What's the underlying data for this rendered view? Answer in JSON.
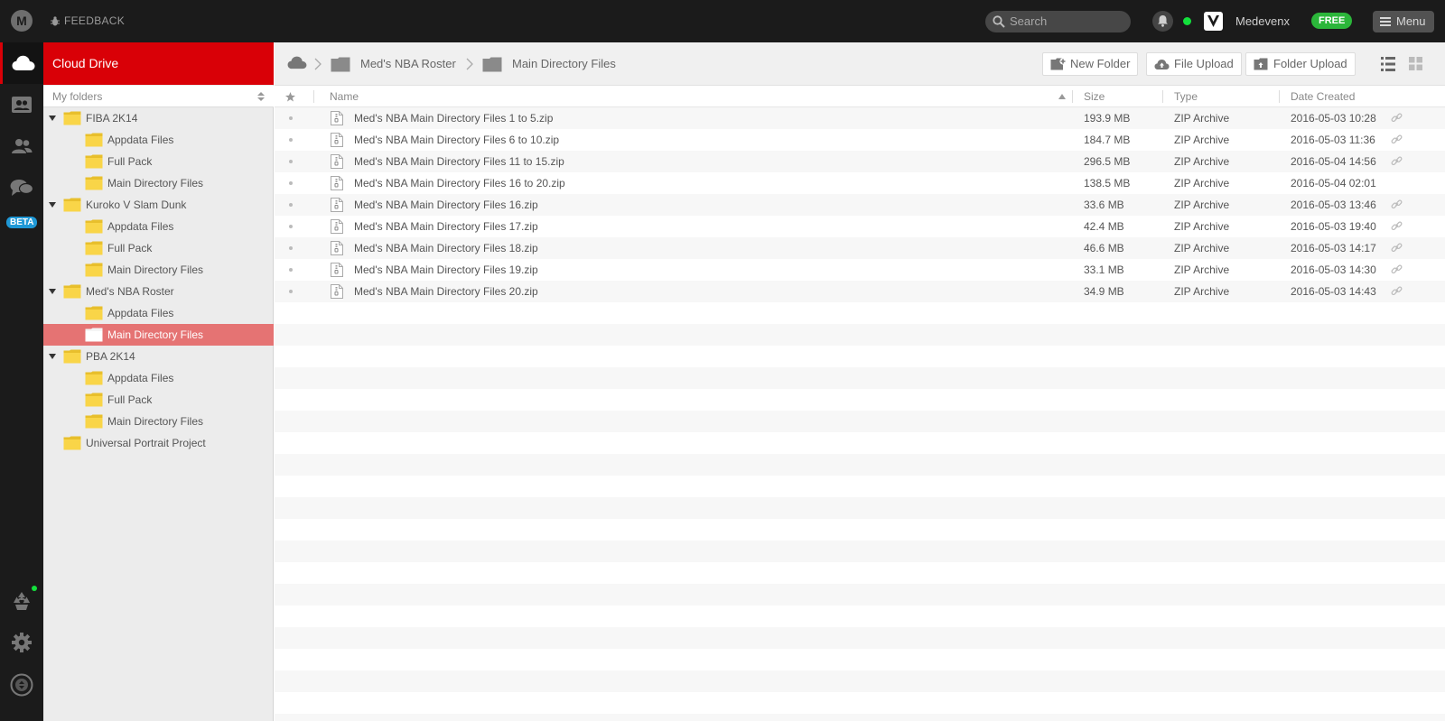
{
  "topbar": {
    "logo_letter": "M",
    "feedback_label": "FEEDBACK",
    "search_placeholder": "Search",
    "username": "Medevenx",
    "plan_badge": "FREE",
    "menu_label": "Menu"
  },
  "rail": {
    "beta_label": "BETA",
    "items": [
      {
        "icon": "cloud-icon",
        "active": true
      },
      {
        "icon": "contacts-icon",
        "active": false
      },
      {
        "icon": "shared-users-icon",
        "active": false
      },
      {
        "icon": "chat-icon",
        "active": false
      },
      {
        "icon": "recycle-bin-icon",
        "active": false
      },
      {
        "icon": "settings-gear-icon",
        "active": false
      },
      {
        "icon": "transfers-icon",
        "active": false
      }
    ]
  },
  "sidebar": {
    "title": "Cloud Drive",
    "my_folders_label": "My folders",
    "tree": [
      {
        "label": "FIBA 2K14",
        "level": 0,
        "expanded": true,
        "selected": false
      },
      {
        "label": "Appdata Files",
        "level": 1,
        "selected": false
      },
      {
        "label": "Full Pack",
        "level": 1,
        "selected": false
      },
      {
        "label": "Main Directory Files",
        "level": 1,
        "selected": false
      },
      {
        "label": "Kuroko V Slam Dunk",
        "level": 0,
        "expanded": true,
        "selected": false
      },
      {
        "label": "Appdata Files",
        "level": 1,
        "selected": false
      },
      {
        "label": "Full Pack",
        "level": 1,
        "selected": false
      },
      {
        "label": "Main Directory Files",
        "level": 1,
        "selected": false
      },
      {
        "label": "Med's NBA Roster",
        "level": 0,
        "expanded": true,
        "selected": false
      },
      {
        "label": "Appdata Files",
        "level": 1,
        "selected": false
      },
      {
        "label": "Main Directory Files",
        "level": 1,
        "selected": true
      },
      {
        "label": "PBA 2K14",
        "level": 0,
        "expanded": true,
        "selected": false
      },
      {
        "label": "Appdata Files",
        "level": 1,
        "selected": false
      },
      {
        "label": "Full Pack",
        "level": 1,
        "selected": false
      },
      {
        "label": "Main Directory Files",
        "level": 1,
        "selected": false
      },
      {
        "label": "Universal Portrait Project",
        "level": 0,
        "expanded": false,
        "leaf": true,
        "selected": false
      }
    ]
  },
  "breadcrumb": {
    "items": [
      "Med's NBA Roster",
      "Main Directory Files"
    ]
  },
  "toolbar": {
    "new_folder_label": "New Folder",
    "file_upload_label": "File Upload",
    "folder_upload_label": "Folder Upload"
  },
  "table": {
    "headers": {
      "name": "Name",
      "size": "Size",
      "type": "Type",
      "date": "Date Created"
    },
    "rows": [
      {
        "name": "Med's NBA Main Directory Files 1 to 5.zip",
        "size": "193.9 MB",
        "type": "ZIP Archive",
        "date": "2016-05-03 10:28",
        "linked": true
      },
      {
        "name": "Med's NBA Main Directory Files 6 to 10.zip",
        "size": "184.7 MB",
        "type": "ZIP Archive",
        "date": "2016-05-03 11:36",
        "linked": true
      },
      {
        "name": "Med's NBA Main Directory Files 11 to 15.zip",
        "size": "296.5 MB",
        "type": "ZIP Archive",
        "date": "2016-05-04 14:56",
        "linked": true
      },
      {
        "name": "Med's NBA Main Directory Files 16 to 20.zip",
        "size": "138.5 MB",
        "type": "ZIP Archive",
        "date": "2016-05-04 02:01",
        "linked": false
      },
      {
        "name": "Med's NBA Main Directory Files 16.zip",
        "size": "33.6 MB",
        "type": "ZIP Archive",
        "date": "2016-05-03 13:46",
        "linked": true
      },
      {
        "name": "Med's NBA Main Directory Files 17.zip",
        "size": "42.4 MB",
        "type": "ZIP Archive",
        "date": "2016-05-03 19:40",
        "linked": true
      },
      {
        "name": "Med's NBA Main Directory Files 18.zip",
        "size": "46.6 MB",
        "type": "ZIP Archive",
        "date": "2016-05-03 14:17",
        "linked": true
      },
      {
        "name": "Med's NBA Main Directory Files 19.zip",
        "size": "33.1 MB",
        "type": "ZIP Archive",
        "date": "2016-05-03 14:30",
        "linked": true
      },
      {
        "name": "Med's NBA Main Directory Files 20.zip",
        "size": "34.9 MB",
        "type": "ZIP Archive",
        "date": "2016-05-03 14:43",
        "linked": true
      }
    ]
  },
  "colors": {
    "accent": "#d90007",
    "selected_folder": "#e57373",
    "folder_yellow": "#f9d548",
    "online": "#13e03c",
    "free_badge": "#2bb63a"
  }
}
